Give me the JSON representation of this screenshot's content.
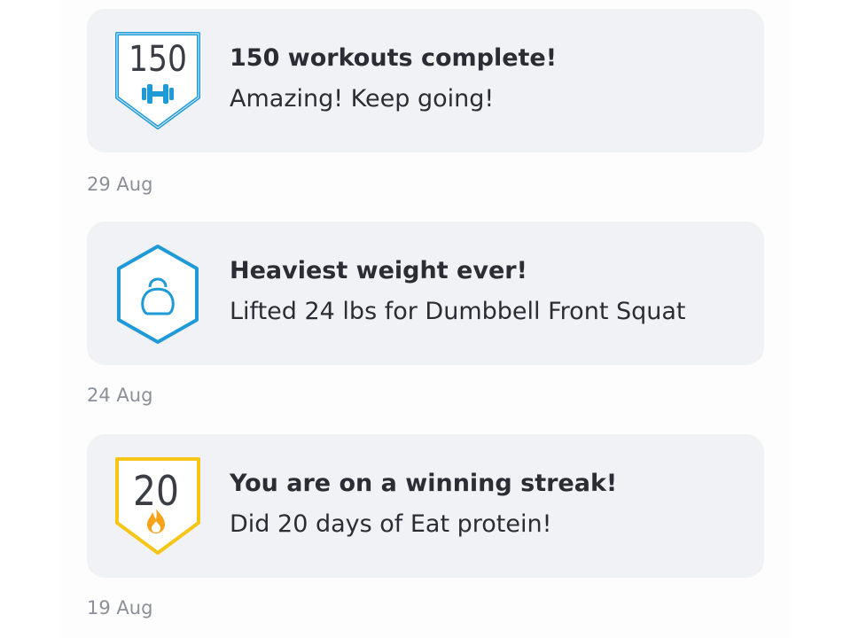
{
  "feed": {
    "items": [
      {
        "badge_icon": "dumbbell-icon",
        "badge_shape": "shield",
        "badge_color": "#1e9ad6",
        "badge_number": "150",
        "title": "150 workouts complete!",
        "subtitle": "Amazing! Keep going!",
        "date": "29 Aug"
      },
      {
        "badge_icon": "kettlebell-icon",
        "badge_shape": "hexagon",
        "badge_color": "#1e9ad6",
        "title": "Heaviest weight ever!",
        "subtitle": "Lifted 24 lbs for Dumbbell Front Squat",
        "date": "24 Aug"
      },
      {
        "badge_icon": "flame-icon",
        "badge_shape": "shield",
        "badge_color": "#f5c518",
        "badge_number": "20",
        "title": "You are on a winning streak!",
        "subtitle": "Did 20 days of Eat protein!",
        "date": "19 Aug"
      }
    ]
  }
}
